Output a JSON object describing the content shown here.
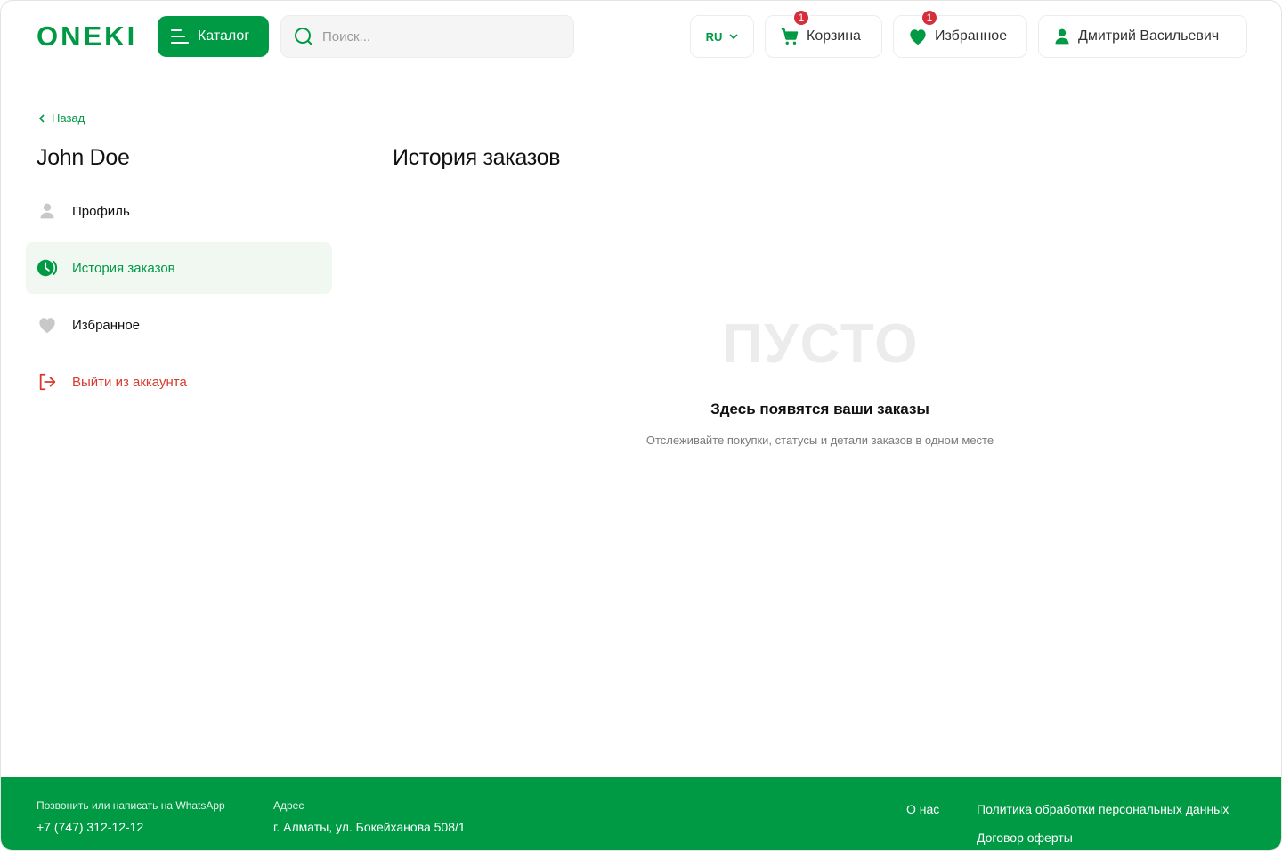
{
  "header": {
    "logo_text": "ONEKI",
    "catalog_label": "Каталог",
    "search_placeholder": "Поиск...",
    "lang": "RU",
    "cart": {
      "label": "Корзина",
      "count": "1"
    },
    "favorites": {
      "label": "Избранное",
      "count": "1"
    },
    "user": {
      "label": "Дмитрий Васильевич"
    }
  },
  "sidebar": {
    "back_label": "Назад",
    "user_name": "John Doe",
    "items": [
      {
        "label": "Профиль",
        "icon": "user-icon"
      },
      {
        "label": "История заказов",
        "icon": "history-icon",
        "active": true
      },
      {
        "label": "Избранное",
        "icon": "heart-icon"
      },
      {
        "label": "Выйти из аккаунта",
        "icon": "logout-icon"
      }
    ]
  },
  "main": {
    "title": "История заказов",
    "empty_art_text": "ПУСТО",
    "empty_title": "Здесь появятся ваши заказы",
    "empty_subtitle": "Отслеживайте покупки, статусы и детали заказов в одном месте"
  },
  "footer": {
    "phone_label": "Позвонить или написать на WhatsApp",
    "phone": "+7 (747) 312-12-12",
    "address_label": "Адрес",
    "address": "г. Алматы, ул. Бокейханова 508/1",
    "links": [
      "О нас",
      "Политика обработки персональных данных",
      "Договор оферты"
    ]
  },
  "colors": {
    "brand": "#009a44",
    "badge": "#d62f3b",
    "logout": "#d63a2f",
    "active_bg": "#f1f8f2"
  }
}
